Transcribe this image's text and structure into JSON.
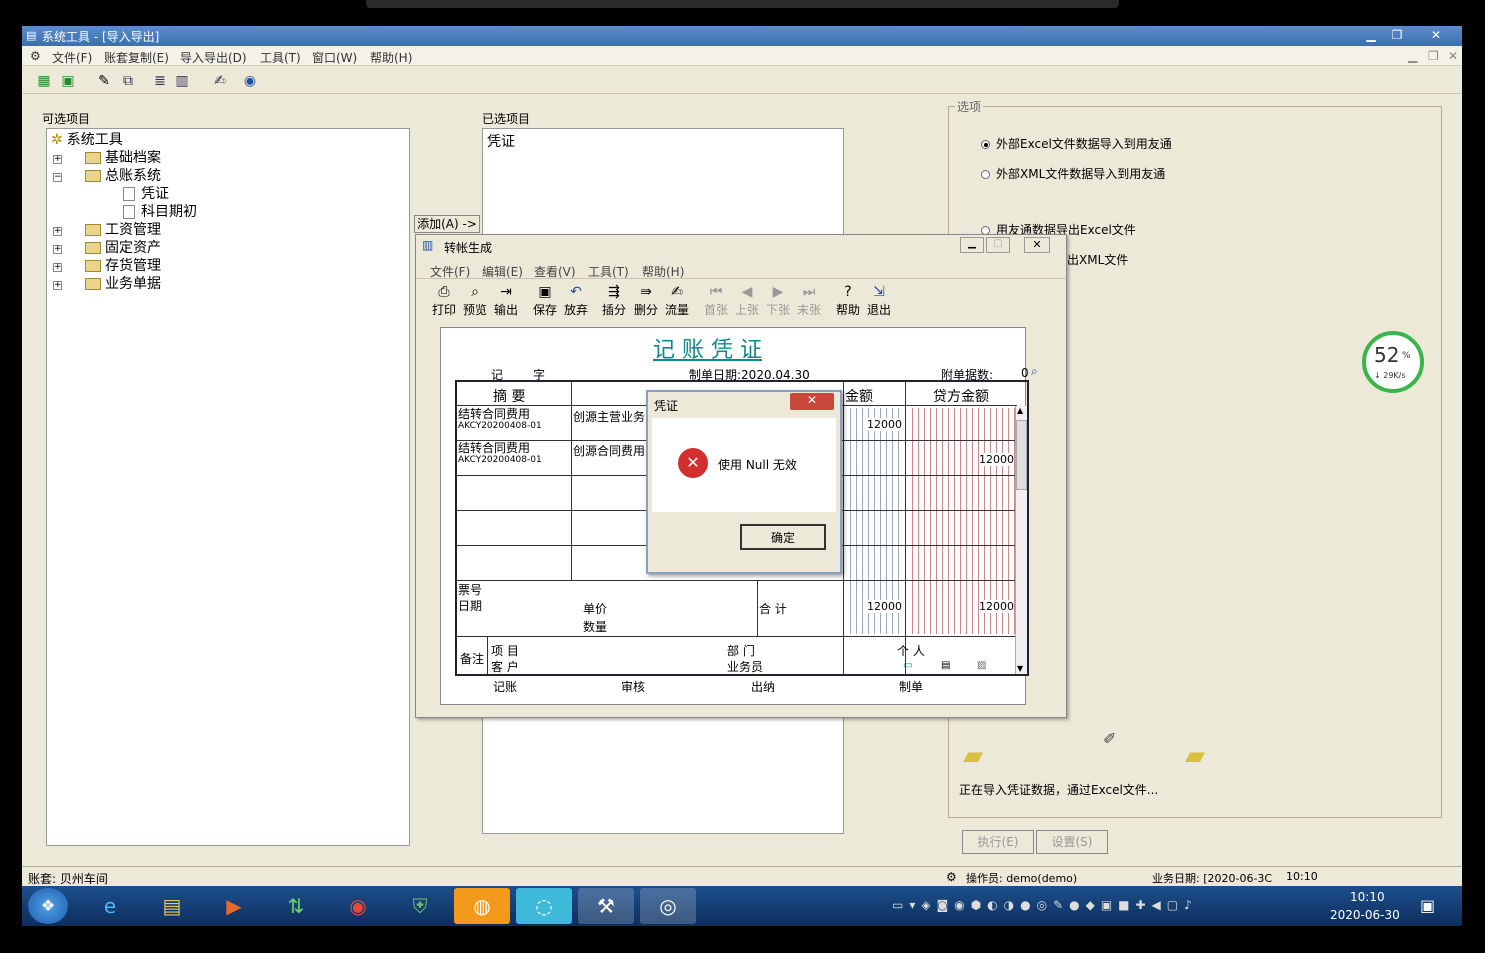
{
  "app": {
    "title": "系统工具 - [导入导出]"
  },
  "menu": [
    "文件(F)",
    "账套复制(E)",
    "导入导出(D)",
    "工具(T)",
    "窗口(W)",
    "帮助(H)"
  ],
  "left_panel": {
    "title": "可选项目",
    "root": "系统工具",
    "items": [
      "基础档案",
      "总账系统",
      "凭证",
      "科目期初",
      "工资管理",
      "固定资产",
      "存货管理",
      "业务单据"
    ]
  },
  "add_button": "添加(A) ->",
  "right_panel": {
    "title": "已选项目",
    "items": [
      "凭证"
    ]
  },
  "options": {
    "group": "选项",
    "opt1": "外部Excel文件数据导入到用友通",
    "opt2": "外部XML文件数据导入到用友通",
    "opt3": "用友通数据导出Excel文件",
    "opt4": "出XML文件",
    "progress_text": "正在导入凭证数据，通过Excel文件...",
    "exec": "执行(E)",
    "settings": "设置(S)"
  },
  "gauge": {
    "percent": "52",
    "unit": "%",
    "speed": "↓ 29K/s"
  },
  "status": {
    "account": "账套: 贝州车间",
    "operator": "操作员: demo(demo)",
    "bizdate": "业务日期: [2020-06-3C",
    "time": "10:10"
  },
  "taskbar": {
    "time": "10:10",
    "date": "2020-06-30"
  },
  "tz": {
    "title": "转帐生成",
    "menu": [
      "文件(F)",
      "编辑(E)",
      "查看(V)",
      "工具(T)",
      "帮助(H)"
    ],
    "toolbar": [
      "打印",
      "预览",
      "输出",
      "保存",
      "放弃",
      "插分",
      "删分",
      "流量",
      "首张",
      "上张",
      "下张",
      "末张",
      "帮助",
      "退出"
    ],
    "voucher": {
      "title": "记 账 凭 证",
      "zi": "记",
      "zi_label": "字",
      "date": "制单日期:2020.04.30",
      "attach": "附单据数:",
      "attach_val": "0",
      "h_summary": "摘 要",
      "h_debit": "金额",
      "h_credit": "贷方金额",
      "rows": [
        {
          "summary": "结转合同费用",
          "code": "AKCY20200408-01",
          "subject": "创源主营业务",
          "debit": "12000",
          "credit": ""
        },
        {
          "summary": "结转合同费用",
          "code": "AKCY20200408-01",
          "subject": "创源合同费用",
          "debit": "",
          "credit": "12000"
        }
      ],
      "ticket_no": "票号",
      "ticket_date": "日期",
      "price": "单价",
      "qty": "数量",
      "total_label": "合 计",
      "total_debit": "12000",
      "total_credit": "12000",
      "remark": "备注",
      "project": "项 目",
      "customer": "客 户",
      "dept": "部 门",
      "salesman": "业务员",
      "person": "个 人",
      "footer": [
        "记账",
        "审核",
        "出纳",
        "制单"
      ]
    }
  },
  "dialog": {
    "title": "凭证",
    "message": "使用 Null 无效",
    "ok": "确定"
  }
}
